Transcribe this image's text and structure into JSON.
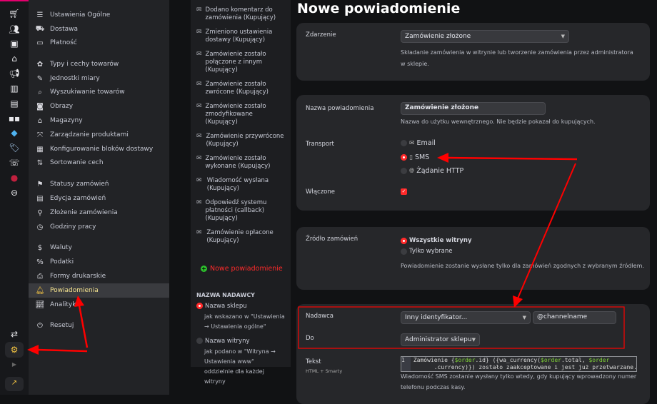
{
  "rail": {
    "icons": [
      "cart-icon",
      "users-icon",
      "archive-icon",
      "home-icon",
      "megaphone-icon",
      "chart-icon",
      "store-icon",
      "apps-icon",
      "diamond-icon",
      "tags-icon",
      "phone-icon",
      "brand-icon",
      "zoom-out-icon"
    ],
    "bottom": [
      "swap-icon",
      "gear-icon",
      "chevron-right-icon",
      "external-link-icon"
    ]
  },
  "sidebar": {
    "items": [
      {
        "label": "Ustawienia Ogólne",
        "icon": "☰"
      },
      {
        "label": "Dostawa",
        "icon": "⛟"
      },
      {
        "label": "Płatność",
        "icon": "▭"
      },
      {
        "label": "Typy i cechy towarów",
        "icon": "✿"
      },
      {
        "label": "Jednostki miary",
        "icon": "✎"
      },
      {
        "label": "Wyszukiwanie towarów",
        "icon": "⌕"
      },
      {
        "label": "Obrazy",
        "icon": "◙"
      },
      {
        "label": "Magazyny",
        "icon": "⌂"
      },
      {
        "label": "Zarządzanie produktami",
        "icon": "⤧"
      },
      {
        "label": "Konfigurowanie bloków dostawy",
        "icon": "▦"
      },
      {
        "label": "Sortowanie cech",
        "icon": "⇅"
      },
      {
        "label": "Statusy zamówień",
        "icon": "⚑"
      },
      {
        "label": "Edycja zamówień",
        "icon": "▤"
      },
      {
        "label": "Złożenie zamówienia",
        "icon": "⚲"
      },
      {
        "label": "Godziny pracy",
        "icon": "◷"
      },
      {
        "label": "Waluty",
        "icon": "$"
      },
      {
        "label": "Podatki",
        "icon": "%"
      },
      {
        "label": "Formy drukarskie",
        "icon": "⎙"
      },
      {
        "label": "Powiadomienia",
        "icon": "🔔"
      },
      {
        "label": "Analityka",
        "icon": "📈"
      },
      {
        "label": "Resetuj",
        "icon": "⏻"
      }
    ]
  },
  "notifications": {
    "items": [
      "Dodano komentarz do zamówienia (Kupujący)",
      "Zmieniono ustawienia dostawy (Kupujący)",
      "Zamówienie zostało połączone z innym (Kupujący)",
      "Zamówienie zostało zwrócone (Kupujący)",
      "Zamówienie zostało zmodyfikowane (Kupujący)",
      "Zamówienie przywrócone (Kupujący)",
      "Zamówienie zostało wykonane (Kupujący)",
      "Wiadomość wysłana (Kupujący)",
      "Odpowiedź systemu płatności (callback) (Kupujący)",
      "Zamówienie opłacone (Kupujący)"
    ],
    "new_label": "Nowe powiadomienie",
    "sender_section": "NAZWA NADAWCY",
    "sender_opt1": "Nazwa sklepu",
    "sender_hint1": "jak wskazano w \"Ustawienia → Ustawienia ogólne\"",
    "sender_opt2": "Nazwa witryny",
    "sender_hint2": "jak podano w \"Witryna → Ustawienia www\" oddzielnie dla każdej witryny"
  },
  "main": {
    "title": "Nowe powiadomienie",
    "event_label": "Zdarzenie",
    "event_value": "Zamówienie złożone",
    "event_hint": "Składanie zamówienia w witrynie lub tworzenie zamówienia przez administratora w sklepie.",
    "name_label": "Nazwa powiadomienia",
    "name_value": "Zamówienie złożone",
    "name_hint": "Nazwa do użytku wewnętrznego. Nie będzie pokazał do kupujących.",
    "transport_label": "Transport",
    "transport_options": [
      "Email",
      "SMS",
      "Żądanie HTTP"
    ],
    "transport_selected": "SMS",
    "enabled_label": "Włączone",
    "enabled": true,
    "source_label": "Źródło zamówień",
    "source_options": [
      "Wszystkie witryny",
      "Tylko wybrane"
    ],
    "source_selected": "Wszystkie witryny",
    "source_hint": "Powiadomienie zostanie wysłane tylko dla zamówień zgodnych z wybranym źródłem.",
    "sender_label": "Nadawca",
    "sender_value": "Inny identyfikator...",
    "sender_input": "@channelname",
    "to_label": "Do",
    "to_value": "Administrator sklepu",
    "text_label": "Tekst",
    "text_sub": "HTML + Smarty",
    "code_line": "1",
    "code_a": "Zamówienie {",
    "code_v1": "$order",
    "code_b": ".id} ({wa_currency(",
    "code_v2": "$order",
    "code_c": ".total, ",
    "code_v3": "$order",
    "code_d": "      .currency)}) zostało zaakceptowane i jest już przetwarzane.",
    "sms_hint": "Wiadomość SMS zostanie wysłany tylko wtedy, gdy kupujący wprowadzony numer telefonu podczas kasy."
  },
  "colors": {
    "accent": "#ff2a2a",
    "active_text": "#f6e48f",
    "annotation": "#ff0000"
  }
}
